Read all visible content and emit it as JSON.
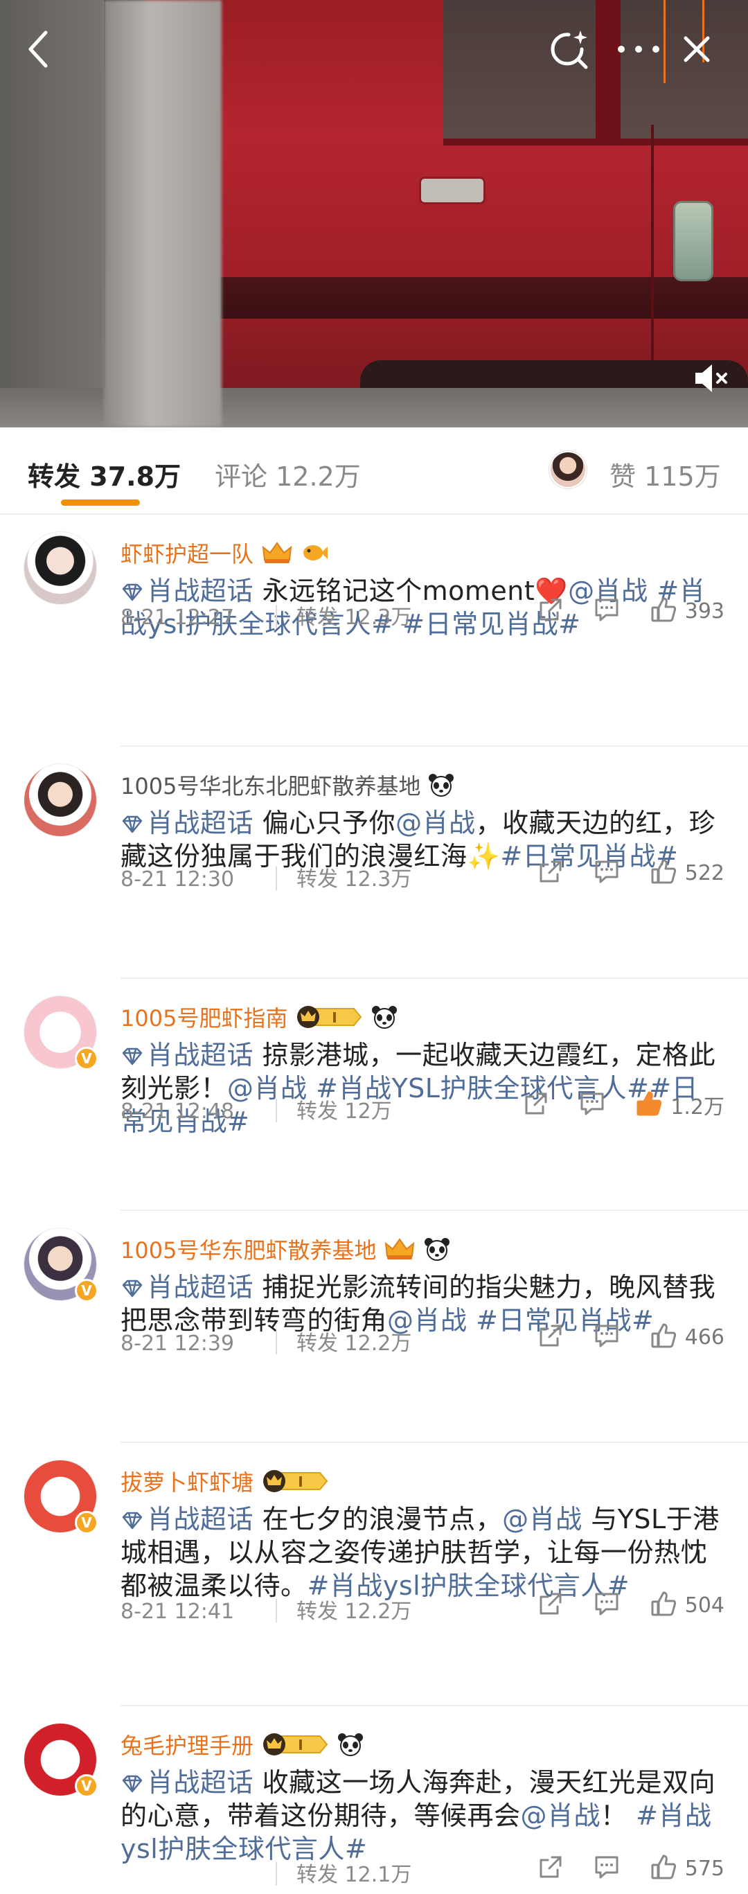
{
  "tabs": {
    "repost_label": "转发",
    "repost_count": "37.8万",
    "comment_label": "评论",
    "comment_count": "12.2万",
    "like_label": "赞",
    "like_count": "115万"
  },
  "colors": {
    "accent": "#f29100",
    "name_orange": "#e8731c",
    "link_blue": "#506d99",
    "liked_orange": "#f28a2d"
  },
  "comments": [
    {
      "username": "虾虾护超一队",
      "name_color": "orange",
      "badges": [
        "crown-medal-icon",
        "fish-icon"
      ],
      "supertopic": "肖战超话",
      "text_parts": [
        {
          "t": "text",
          "v": " 永远铭记这个moment"
        },
        {
          "t": "emoji",
          "v": "❤️"
        },
        {
          "t": "mention",
          "v": "@肖战"
        },
        {
          "t": "text",
          "v": " "
        },
        {
          "t": "topic",
          "v": "#肖战ysl护肤全球代言人#"
        },
        {
          "t": "text",
          "v": " "
        },
        {
          "t": "topic",
          "v": "#日常见肖战#"
        }
      ],
      "time": "8-21 12:27",
      "repost": "转发 12.3万",
      "likes": "393",
      "liked": false
    },
    {
      "username": "1005号华北东北肥虾散养基地",
      "name_color": "gray",
      "badges": [
        "panda-icon"
      ],
      "supertopic": "肖战超话",
      "text_parts": [
        {
          "t": "text",
          "v": " 偏心只予你"
        },
        {
          "t": "mention",
          "v": "@肖战"
        },
        {
          "t": "text",
          "v": "，收藏天边的红，珍藏这份独属于我们的浪漫红海"
        },
        {
          "t": "emoji",
          "v": "✨"
        },
        {
          "t": "topic",
          "v": "#日常见肖战#"
        }
      ],
      "time": "8-21 12:30",
      "repost": "转发 12.3万",
      "likes": "522",
      "liked": false
    },
    {
      "username": "1005号肥虾指南",
      "name_color": "orange",
      "badges": [
        "level-medal-icon",
        "panda-icon"
      ],
      "verified": true,
      "supertopic": "肖战超话",
      "text_parts": [
        {
          "t": "text",
          "v": " 掠影港城，一起收藏天边霞红，定格此刻光影！"
        },
        {
          "t": "mention",
          "v": "@肖战"
        },
        {
          "t": "text",
          "v": " "
        },
        {
          "t": "topic",
          "v": "#肖战YSL护肤全球代言人##日常见肖战#"
        }
      ],
      "time": "8-21 12:48",
      "repost": "转发 12万",
      "likes": "1.2万",
      "liked": true
    },
    {
      "username": "1005号华东肥虾散养基地",
      "name_color": "orange",
      "badges": [
        "crown-medal-icon",
        "panda-icon"
      ],
      "verified": true,
      "supertopic": "肖战超话",
      "text_parts": [
        {
          "t": "text",
          "v": " 捕捉光影流转间的指尖魅力，晚风替我把思念带到转弯的街角"
        },
        {
          "t": "mention",
          "v": "@肖战"
        },
        {
          "t": "text",
          "v": " "
        },
        {
          "t": "topic",
          "v": "#日常见肖战#"
        }
      ],
      "time": "8-21 12:39",
      "repost": "转发 12.2万",
      "likes": "466",
      "liked": false
    },
    {
      "username": "拔萝卜虾虾塘",
      "name_color": "orange",
      "badges": [
        "level-medal-icon"
      ],
      "verified": true,
      "supertopic": "肖战超话",
      "text_parts": [
        {
          "t": "text",
          "v": " 在七夕的浪漫节点，"
        },
        {
          "t": "mention",
          "v": "@肖战"
        },
        {
          "t": "text",
          "v": " 与YSL于港城相遇，以从容之姿传递护肤哲学，让每一份热忱都被温柔以待。"
        },
        {
          "t": "topic",
          "v": "#肖战ysl护肤全球代言人#"
        }
      ],
      "time": "8-21 12:41",
      "repost": "转发 12.2万",
      "likes": "504",
      "liked": false
    },
    {
      "username": "兔毛护理手册",
      "name_color": "orange",
      "badges": [
        "level-medal-icon",
        "panda-icon"
      ],
      "verified": true,
      "supertopic": "肖战超话",
      "text_parts": [
        {
          "t": "text",
          "v": " 收藏这一场人海奔赴，漫天红光是双向的心意，带着这份期待，等候再会"
        },
        {
          "t": "mention",
          "v": "@肖战"
        },
        {
          "t": "text",
          "v": "！ "
        },
        {
          "t": "topic",
          "v": "#肖战ysl护肤全球代言人#"
        }
      ],
      "time": "",
      "repost": "转发 12.1万",
      "likes": "575",
      "liked": false
    }
  ]
}
